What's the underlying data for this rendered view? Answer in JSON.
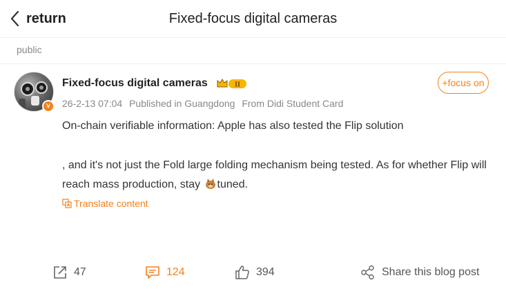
{
  "header": {
    "back_label": "return",
    "title": "Fixed-focus digital cameras"
  },
  "visibility": "public",
  "post": {
    "author": {
      "name": "Fixed-focus digital cameras",
      "level_badge": "II",
      "verified_mark": "v"
    },
    "follow_label": "+focus on",
    "meta": {
      "datetime": "26-2-13 07:04",
      "location": "Published in Guangdong",
      "source": "From Didi Student Card"
    },
    "text_line_1": "On-chain verifiable information: Apple has also tested the Flip solution",
    "text_line_2_a": ", and it's not just the Fold large folding mechanism being tested. As for whether Flip will reach mass production, stay ",
    "text_line_2_b": "tuned.",
    "translate_label": "Translate content"
  },
  "actions": {
    "repost_count": "47",
    "comment_count": "124",
    "like_count": "394",
    "share_label": "Share this blog post"
  },
  "colors": {
    "accent": "#f3801c",
    "text": "#333333",
    "muted": "#888888"
  },
  "icons": {
    "back": "chevron-left-icon",
    "repost": "repost-icon",
    "comment": "comment-icon",
    "like": "thumbs-up-icon",
    "share": "share-icon",
    "translate": "translate-icon",
    "emoji": "doge-emoji-icon"
  }
}
